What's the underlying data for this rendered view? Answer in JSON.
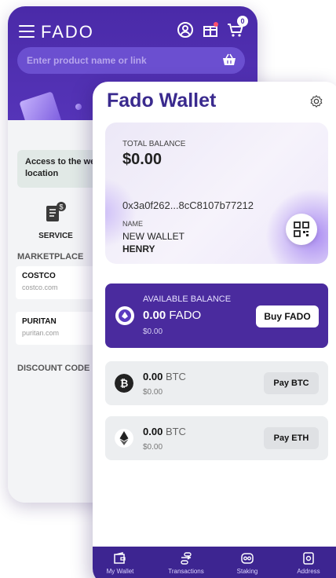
{
  "shop": {
    "brand": "FADO",
    "cart_count": "0",
    "search_placeholder": "Enter product name or link",
    "access_text": "Access to the website location",
    "service_label": "SERVICE",
    "marketplace_label": "MARKETPLACE",
    "stores": [
      {
        "name": "COSTCO",
        "url": "costco.com"
      },
      {
        "name": "PURITAN",
        "url": "puritan.com"
      }
    ],
    "discount_label": "DISCOUNT CODE",
    "icons": [
      "menu-icon",
      "user-icon",
      "gift-icon",
      "cart-icon",
      "basket-icon",
      "service-icon"
    ]
  },
  "wallet": {
    "title": "Fado Wallet",
    "total_balance_label": "TOTAL BALANCE",
    "total_balance": "$0.00",
    "address": "0x3a0f262...8cC8107b77212",
    "name_label": "NAME",
    "wallet_name": "NEW WALLET",
    "user_name": "HENRY",
    "available": {
      "label": "AVAILABLE BALANCE",
      "amount": "0.00",
      "currency": "FADO",
      "usd": "$0.00",
      "button": "Buy FADO"
    },
    "coins": [
      {
        "amount": "0.00",
        "currency": "BTC",
        "usd": "$0.00",
        "button": "Pay BTC",
        "icon": "bitcoin-icon"
      },
      {
        "amount": "0.00",
        "currency": "BTC",
        "usd": "$0.00",
        "button": "Pay ETH",
        "icon": "ethereum-icon"
      }
    ],
    "nav": [
      {
        "label": "My Wallet",
        "icon": "wallet-icon"
      },
      {
        "label": "Transactions",
        "icon": "transactions-icon"
      },
      {
        "label": "Staking",
        "icon": "staking-icon"
      },
      {
        "label": "Address",
        "icon": "address-icon"
      }
    ]
  },
  "colors": {
    "brand_purple": "#4a2aa8",
    "card_purple": "#4a2b9e",
    "nav_purple": "#3d2591",
    "title_purple": "#3a2a8e"
  }
}
